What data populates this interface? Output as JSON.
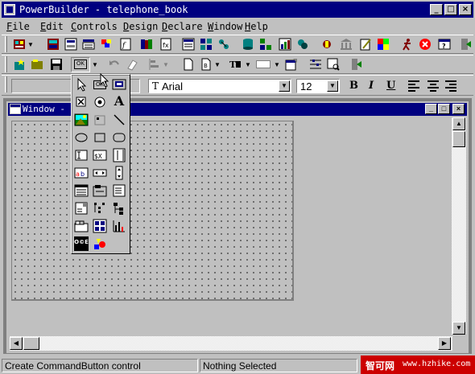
{
  "app": {
    "title": "PowerBuilder - telephone_book"
  },
  "menu": {
    "items": [
      {
        "label": "File"
      },
      {
        "label": "Edit"
      },
      {
        "label": "Controls"
      },
      {
        "label": "Design"
      },
      {
        "label": "Declare"
      },
      {
        "label": "Window"
      },
      {
        "label": "Help"
      }
    ]
  },
  "toolbar2": {
    "commandbutton_label": "OK"
  },
  "formatbar": {
    "style_value": "",
    "font_value": "Arial",
    "font_prefix": "T",
    "size_value": "12",
    "bold_label": "B",
    "italic_label": "I",
    "underline_label": "U"
  },
  "child_window": {
    "title": "Window - C"
  },
  "palette": {
    "commandbutton_label": "OK",
    "statictext_label": "A",
    "picture_glyph": "O©E",
    "items": [
      "pointer-icon",
      "commandbutton-icon",
      "picturebutton-icon",
      "checkbox-icon",
      "radiobutton-icon",
      "statictext-icon",
      "picture-icon",
      "user-object-icon",
      "line-icon",
      "oval-icon",
      "rectangle-icon",
      "roundrectangle-icon",
      "singlelineedit-icon",
      "editmask-icon",
      "multilineedit-icon",
      "richtextedit-icon",
      "hscrollbar-icon",
      "vscrollbar-icon",
      "datawindow-icon",
      "groupbox-icon",
      "listbox-icon",
      "dropdownlistbox-icon",
      "treeview-icon",
      "tree-icon",
      "tab-icon",
      "listview-icon",
      "graph-icon",
      "ole-icon",
      "shapes-icon"
    ]
  },
  "status": {
    "hint": "Create CommandButton control",
    "selection": "Nothing Selected"
  },
  "watermark": {
    "brand": "智可网",
    "url": "www.hzhike.com"
  },
  "colors": {
    "titlebar": "#000080",
    "face": "#c0c0c0",
    "workspace": "#808080"
  }
}
